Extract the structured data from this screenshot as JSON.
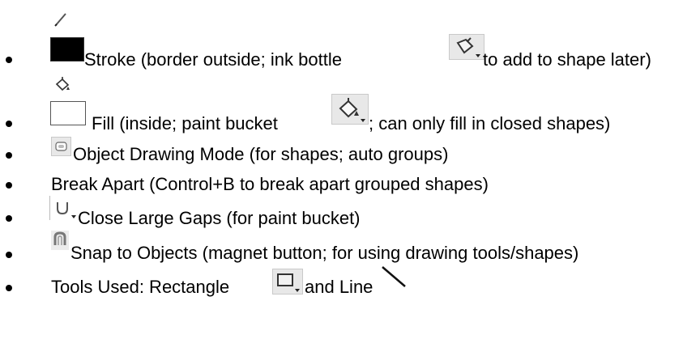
{
  "items": [
    {
      "text_before": "Stroke (border outside; ink bottle ",
      "text_after": " to add to shape later)",
      "icons": [
        "pencil-icon",
        "black-swatch-icon",
        "ink-bottle-icon"
      ]
    },
    {
      "text_before": "Fill (inside; paint bucket ",
      "text_after": "; can only fill in closed shapes)",
      "icons": [
        "paint-bucket-small-icon",
        "white-swatch-icon",
        "paint-bucket-icon"
      ]
    },
    {
      "text": "Object Drawing Mode (for shapes; auto groups)",
      "icons": [
        "object-drawing-icon"
      ]
    },
    {
      "text": "Break Apart (Control+B to break apart grouped shapes)"
    },
    {
      "text": "Close Large Gaps (for paint bucket)",
      "icons": [
        "gap-close-icon"
      ]
    },
    {
      "text": "Snap to Objects (magnet button; for using drawing tools/shapes)",
      "icons": [
        "magnet-icon"
      ]
    },
    {
      "text_before": "Tools Used: Rectangle ",
      "text_mid": " and Line",
      "icons": [
        "rectangle-tool-icon",
        "line-tool-icon"
      ]
    }
  ],
  "colors": {
    "stroke_swatch": "#000000",
    "fill_swatch": "#ffffff"
  }
}
